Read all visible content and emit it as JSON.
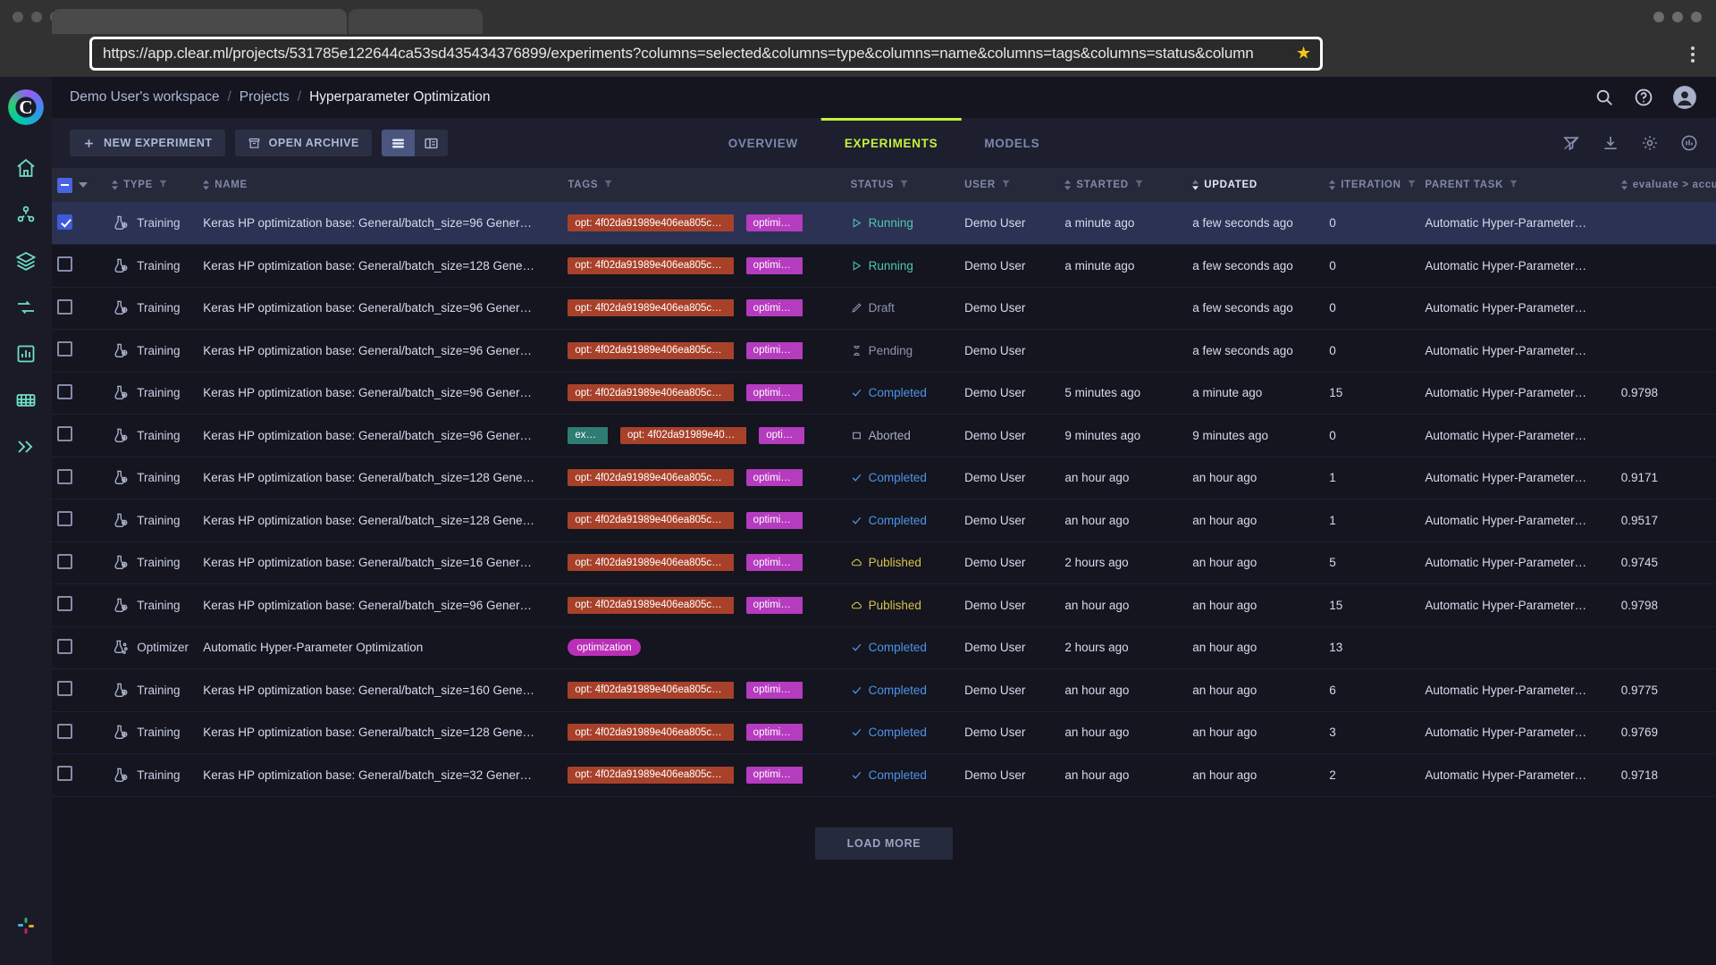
{
  "browser": {
    "url": "https://app.clear.ml/projects/531785e122644ca53sd435434376899/experiments?columns=selected&columns=type&columns=name&columns=tags&columns=status&column",
    "star_icon": "star-icon",
    "menu_icon": "kebab-menu-icon"
  },
  "header": {
    "breadcrumb": [
      {
        "label": "Demo User's workspace"
      },
      {
        "label": "Projects"
      },
      {
        "label": "Hyperparameter Optimization"
      }
    ],
    "separator": "/",
    "icons": [
      "search-icon",
      "help-icon",
      "account-icon"
    ]
  },
  "toolbar": {
    "new_experiment_label": "NEW EXPERIMENT",
    "open_archive_label": "OPEN ARCHIVE",
    "view_table_icon": "table-view-icon",
    "view_split_icon": "split-view-icon",
    "right_icons": [
      "filter-off-icon",
      "download-icon",
      "settings-icon",
      "compare-icon"
    ]
  },
  "tabs": [
    {
      "label": "OVERVIEW",
      "active": false
    },
    {
      "label": "EXPERIMENTS",
      "active": true
    },
    {
      "label": "MODELS",
      "active": false
    }
  ],
  "accent_color": "#c6f23c",
  "columns": [
    {
      "key": "selected",
      "label": "",
      "sortable": false,
      "filter": false
    },
    {
      "key": "type",
      "label": "TYPE",
      "sortable": true,
      "filter": true
    },
    {
      "key": "name",
      "label": "NAME",
      "sortable": true,
      "filter": false
    },
    {
      "key": "tags",
      "label": "TAGS",
      "sortable": false,
      "filter": true
    },
    {
      "key": "status",
      "label": "STATUS",
      "sortable": false,
      "filter": true
    },
    {
      "key": "user",
      "label": "USER",
      "sortable": false,
      "filter": true
    },
    {
      "key": "started",
      "label": "STARTED",
      "sortable": true,
      "filter": true
    },
    {
      "key": "updated",
      "label": "UPDATED",
      "sortable": true,
      "filter": false,
      "active": true
    },
    {
      "key": "iteration",
      "label": "ITERATION",
      "sortable": true,
      "filter": true
    },
    {
      "key": "parent",
      "label": "PARENT TASK",
      "sortable": false,
      "filter": true
    },
    {
      "key": "metric",
      "label": "evaluate > accura",
      "sortable": true,
      "filter": false
    }
  ],
  "rows": [
    {
      "selected": true,
      "type": "Training",
      "name": "Keras HP optimization base: General/batch_size=96 Gener…",
      "tags": [
        {
          "text": "opt: 4f02da91989e406ea805c…",
          "color": "red"
        },
        {
          "text": "optimi…",
          "color": "purple"
        }
      ],
      "status": "Running",
      "status_key": "running",
      "user": "Demo User",
      "started": "a minute ago",
      "updated": "a few seconds ago",
      "iteration": "0",
      "parent": "Automatic Hyper-Parameter…",
      "metric": ""
    },
    {
      "selected": false,
      "type": "Training",
      "name": "Keras HP optimization base: General/batch_size=128 Gene…",
      "tags": [
        {
          "text": "opt: 4f02da91989e406ea805c…",
          "color": "red"
        },
        {
          "text": "optimi…",
          "color": "purple"
        }
      ],
      "status": "Running",
      "status_key": "running",
      "user": "Demo User",
      "started": "a minute ago",
      "updated": "a few seconds ago",
      "iteration": "0",
      "parent": "Automatic Hyper-Parameter…",
      "metric": ""
    },
    {
      "selected": false,
      "type": "Training",
      "name": "Keras HP optimization base: General/batch_size=96 Gener…",
      "tags": [
        {
          "text": "opt: 4f02da91989e406ea805c…",
          "color": "red"
        },
        {
          "text": "optimi…",
          "color": "purple"
        }
      ],
      "status": "Draft",
      "status_key": "draft",
      "user": "Demo User",
      "started": "",
      "updated": "a few seconds ago",
      "iteration": "0",
      "parent": "Automatic Hyper-Parameter…",
      "metric": ""
    },
    {
      "selected": false,
      "type": "Training",
      "name": "Keras HP optimization base: General/batch_size=96 Gener…",
      "tags": [
        {
          "text": "opt: 4f02da91989e406ea805c…",
          "color": "red"
        },
        {
          "text": "optimi…",
          "color": "purple"
        }
      ],
      "status": "Pending",
      "status_key": "pending",
      "user": "Demo User",
      "started": "",
      "updated": "a few seconds ago",
      "iteration": "0",
      "parent": "Automatic Hyper-Parameter…",
      "metric": ""
    },
    {
      "selected": false,
      "type": "Training",
      "name": "Keras HP optimization base: General/batch_size=96 Gener…",
      "tags": [
        {
          "text": "opt: 4f02da91989e406ea805c…",
          "color": "red"
        },
        {
          "text": "optimi…",
          "color": "purple"
        }
      ],
      "status": "Completed",
      "status_key": "completed",
      "user": "Demo User",
      "started": "5 minutes ago",
      "updated": "a minute ago",
      "iteration": "15",
      "parent": "Automatic Hyper-Parameter…",
      "metric": "0.9798"
    },
    {
      "selected": false,
      "type": "Training",
      "name": "Keras HP optimization base: General/batch_size=96 Gener…",
      "tags": [
        {
          "text": "ex…",
          "color": "teal"
        },
        {
          "text": "opt: 4f02da91989e40…",
          "color": "red"
        },
        {
          "text": "opti…",
          "color": "purple"
        }
      ],
      "status": "Aborted",
      "status_key": "aborted",
      "user": "Demo User",
      "started": "9 minutes ago",
      "updated": "9 minutes ago",
      "iteration": "0",
      "parent": "Automatic Hyper-Parameter…",
      "metric": ""
    },
    {
      "selected": false,
      "type": "Training",
      "name": "Keras HP optimization base: General/batch_size=128 Gene…",
      "tags": [
        {
          "text": "opt: 4f02da91989e406ea805c…",
          "color": "red"
        },
        {
          "text": "optimi…",
          "color": "purple"
        }
      ],
      "status": "Completed",
      "status_key": "completed",
      "user": "Demo User",
      "started": "an hour ago",
      "updated": "an hour ago",
      "iteration": "1",
      "parent": "Automatic Hyper-Parameter…",
      "metric": "0.9171"
    },
    {
      "selected": false,
      "type": "Training",
      "name": "Keras HP optimization base: General/batch_size=128 Gene…",
      "tags": [
        {
          "text": "opt: 4f02da91989e406ea805c…",
          "color": "red"
        },
        {
          "text": "optimi…",
          "color": "purple"
        }
      ],
      "status": "Completed",
      "status_key": "completed",
      "user": "Demo User",
      "started": "an hour ago",
      "updated": "an hour ago",
      "iteration": "1",
      "parent": "Automatic Hyper-Parameter…",
      "metric": "0.9517"
    },
    {
      "selected": false,
      "type": "Training",
      "name": "Keras HP optimization base: General/batch_size=16 Gener…",
      "tags": [
        {
          "text": "opt: 4f02da91989e406ea805c…",
          "color": "red"
        },
        {
          "text": "optimi…",
          "color": "purple"
        }
      ],
      "status": "Published",
      "status_key": "published",
      "user": "Demo User",
      "started": "2 hours ago",
      "updated": "an hour ago",
      "iteration": "5",
      "parent": "Automatic Hyper-Parameter…",
      "metric": "0.9745"
    },
    {
      "selected": false,
      "type": "Training",
      "name": "Keras HP optimization base: General/batch_size=96 Gener…",
      "tags": [
        {
          "text": "opt: 4f02da91989e406ea805c…",
          "color": "red"
        },
        {
          "text": "optimi…",
          "color": "purple"
        }
      ],
      "status": "Published",
      "status_key": "published",
      "user": "Demo User",
      "started": "an hour ago",
      "updated": "an hour ago",
      "iteration": "15",
      "parent": "Automatic Hyper-Parameter…",
      "metric": "0.9798"
    },
    {
      "selected": false,
      "type": "Optimizer",
      "name": "Automatic Hyper-Parameter Optimization",
      "tags": [
        {
          "text": "optimization",
          "color": "magenta"
        }
      ],
      "status": "Completed",
      "status_key": "completed",
      "user": "Demo User",
      "started": "2 hours ago",
      "updated": "an hour ago",
      "iteration": "13",
      "parent": "",
      "metric": ""
    },
    {
      "selected": false,
      "type": "Training",
      "name": "Keras HP optimization base: General/batch_size=160 Gene…",
      "tags": [
        {
          "text": "opt: 4f02da91989e406ea805c…",
          "color": "red"
        },
        {
          "text": "optimi…",
          "color": "purple"
        }
      ],
      "status": "Completed",
      "status_key": "completed",
      "user": "Demo User",
      "started": "an hour ago",
      "updated": "an hour ago",
      "iteration": "6",
      "parent": "Automatic Hyper-Parameter…",
      "metric": "0.9775"
    },
    {
      "selected": false,
      "type": "Training",
      "name": "Keras HP optimization base: General/batch_size=128 Gene…",
      "tags": [
        {
          "text": "opt: 4f02da91989e406ea805c…",
          "color": "red"
        },
        {
          "text": "optimi…",
          "color": "purple"
        }
      ],
      "status": "Completed",
      "status_key": "completed",
      "user": "Demo User",
      "started": "an hour ago",
      "updated": "an hour ago",
      "iteration": "3",
      "parent": "Automatic Hyper-Parameter…",
      "metric": "0.9769"
    },
    {
      "selected": false,
      "type": "Training",
      "name": "Keras HP optimization base: General/batch_size=32 Gener…",
      "tags": [
        {
          "text": "opt: 4f02da91989e406ea805c…",
          "color": "red"
        },
        {
          "text": "optimi…",
          "color": "purple"
        }
      ],
      "status": "Completed",
      "status_key": "completed",
      "user": "Demo User",
      "started": "an hour ago",
      "updated": "an hour ago",
      "iteration": "2",
      "parent": "Automatic Hyper-Parameter…",
      "metric": "0.9718"
    }
  ],
  "footer": {
    "load_more_label": "LOAD MORE"
  },
  "sidebar": {
    "logo_letter": "C",
    "items": [
      {
        "name": "home-icon"
      },
      {
        "name": "projects-icon"
      },
      {
        "name": "datasets-icon"
      },
      {
        "name": "pipelines-icon"
      },
      {
        "name": "reports-icon"
      },
      {
        "name": "workers-icon"
      },
      {
        "name": "serving-icon"
      }
    ],
    "bottom_item": {
      "name": "slack-icon"
    }
  }
}
